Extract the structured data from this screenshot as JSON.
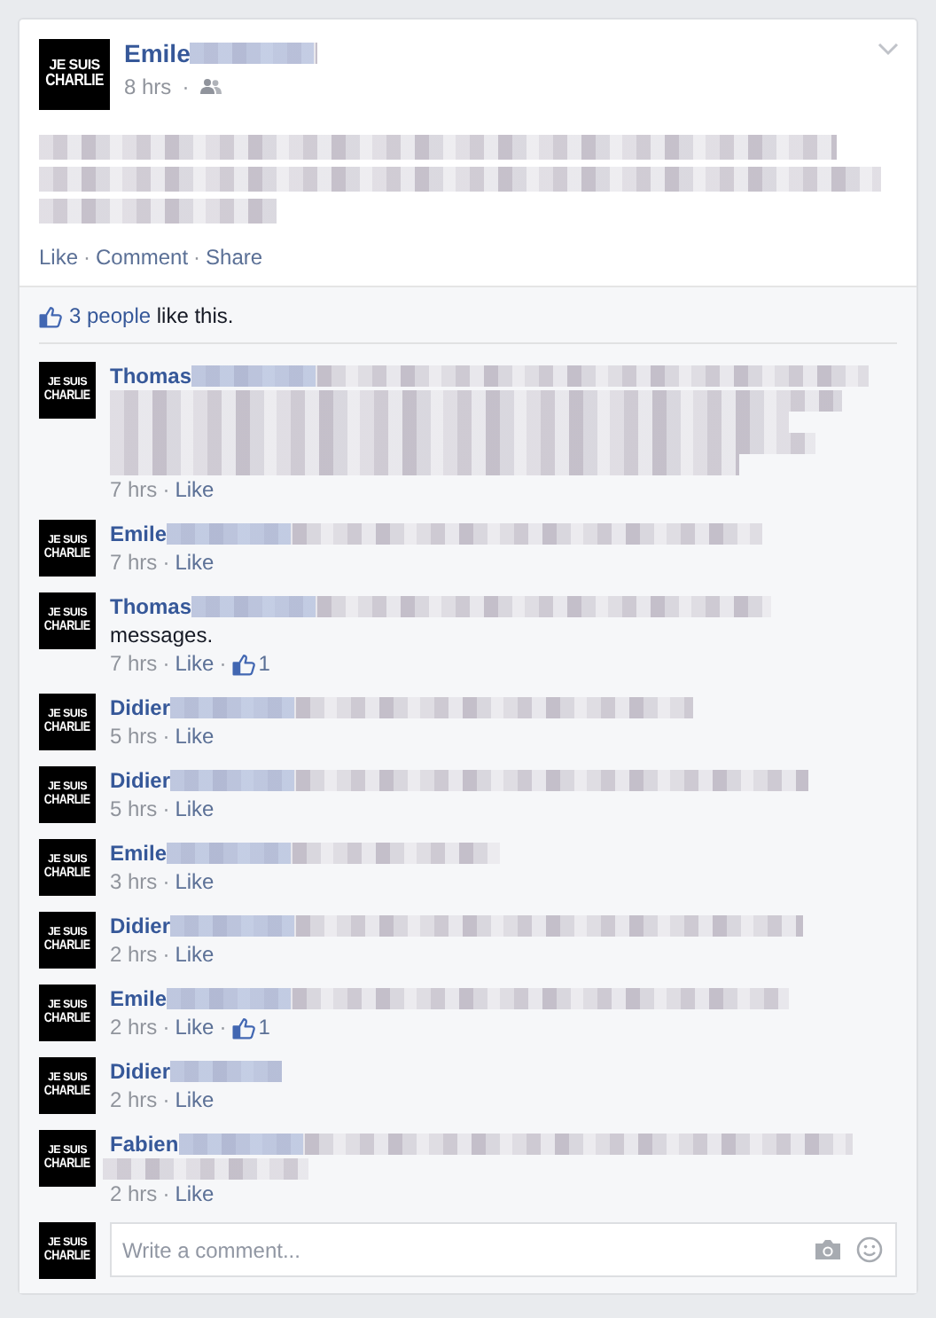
{
  "post": {
    "author": "Emile",
    "avatar": {
      "line_1": "JE SUIS",
      "line_2": "CHARLIE"
    },
    "time": "8 hrs",
    "separator": "·",
    "actions": [
      "Like",
      "Comment",
      "Share"
    ],
    "likes": {
      "people": "3 people",
      "text": "like this."
    }
  },
  "comments": [
    {
      "author": "Thomas",
      "avatar": {
        "line_1": "JE SUIS",
        "line_2": "CHARLIE"
      },
      "time": "7 hrs",
      "action": "Like"
    },
    {
      "author": "Emile",
      "avatar": {
        "line_1": "JE SUIS",
        "line_2": "CHARLIE"
      },
      "time": "7 hrs",
      "action": "Like"
    },
    {
      "author": "Thomas",
      "avatar": {
        "line_1": "JE SUIS",
        "line_2": "CHARLIE"
      },
      "text_end": "messages.",
      "time": "7 hrs",
      "action": "Like",
      "like_count": "1"
    },
    {
      "author": "Didier",
      "avatar": {
        "line_1": "JE SUIS",
        "line_2": "CHARLIE"
      },
      "time": "5 hrs",
      "action": "Like"
    },
    {
      "author": "Didier",
      "avatar": {
        "line_1": "JE SUIS",
        "line_2": "CHARLIE"
      },
      "time": "5 hrs",
      "action": "Like"
    },
    {
      "author": "Emile",
      "avatar": {
        "line_1": "JE SUIS",
        "line_2": "CHARLIE"
      },
      "time": "3 hrs",
      "action": "Like"
    },
    {
      "author": "Didier",
      "avatar": {
        "line_1": "JE SUIS",
        "line_2": "CHARLIE"
      },
      "time": "2 hrs",
      "action": "Like"
    },
    {
      "author": "Emile",
      "avatar": {
        "line_1": "JE SUIS",
        "line_2": "CHARLIE"
      },
      "time": "2 hrs",
      "action": "Like",
      "like_count": "1"
    },
    {
      "author": "Didier",
      "avatar": {
        "line_1": "JE SUIS",
        "line_2": "CHARLIE"
      },
      "time": "2 hrs",
      "action": "Like"
    },
    {
      "author": "Fabien",
      "avatar": {
        "line_1": "JE SUIS",
        "line_2": "CHARLIE"
      },
      "time": "2 hrs",
      "action": "Like"
    }
  ],
  "composer": {
    "avatar": {
      "line_1": "JE SUIS",
      "line_2": "CHARLIE"
    },
    "placeholder": "Write a comment..."
  }
}
